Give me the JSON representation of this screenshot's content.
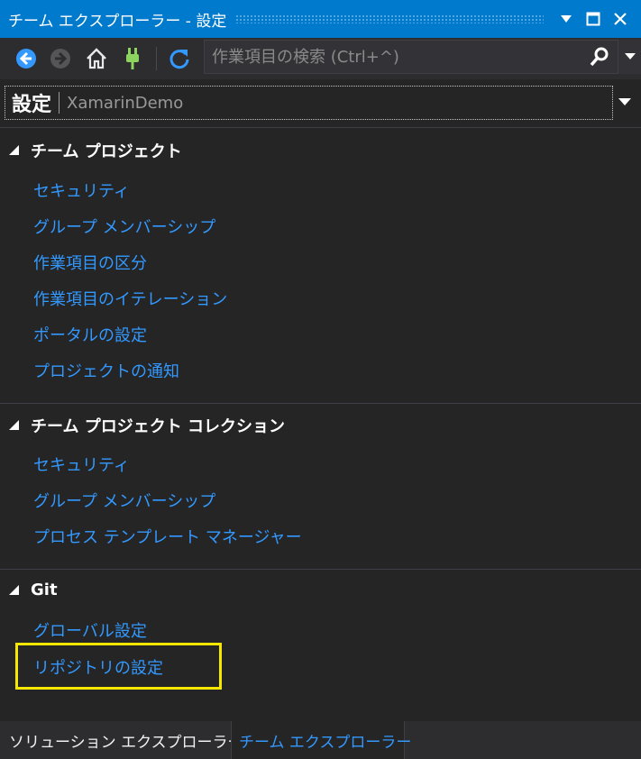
{
  "window": {
    "title": "チーム エクスプローラー - 設定"
  },
  "toolbar": {
    "search_placeholder": "作業項目の検索 (Ctrl+^)"
  },
  "page_header": {
    "title": "設定",
    "project": "XamarinDemo"
  },
  "sections": [
    {
      "title": "チーム プロジェクト",
      "links": [
        "セキュリティ",
        "グループ メンバーシップ",
        "作業項目の区分",
        "作業項目のイテレーション",
        "ポータルの設定",
        "プロジェクトの通知"
      ]
    },
    {
      "title": "チーム プロジェクト コレクション",
      "links": [
        "セキュリティ",
        "グループ メンバーシップ",
        "プロセス テンプレート マネージャー"
      ]
    },
    {
      "title": "Git",
      "links": [
        "グローバル設定",
        "リポジトリの設定"
      ]
    }
  ],
  "bottom_tabs": [
    "ソリューション エクスプローラー",
    "チーム エクスプローラー"
  ],
  "colors": {
    "accent": "#007acc",
    "link": "#3399ff",
    "highlight": "#f5e700",
    "background": "#252526"
  },
  "icons": [
    "back-icon",
    "forward-icon",
    "home-icon",
    "connect-plug-icon",
    "refresh-icon",
    "search-icon",
    "dropdown-arrow-icon"
  ]
}
